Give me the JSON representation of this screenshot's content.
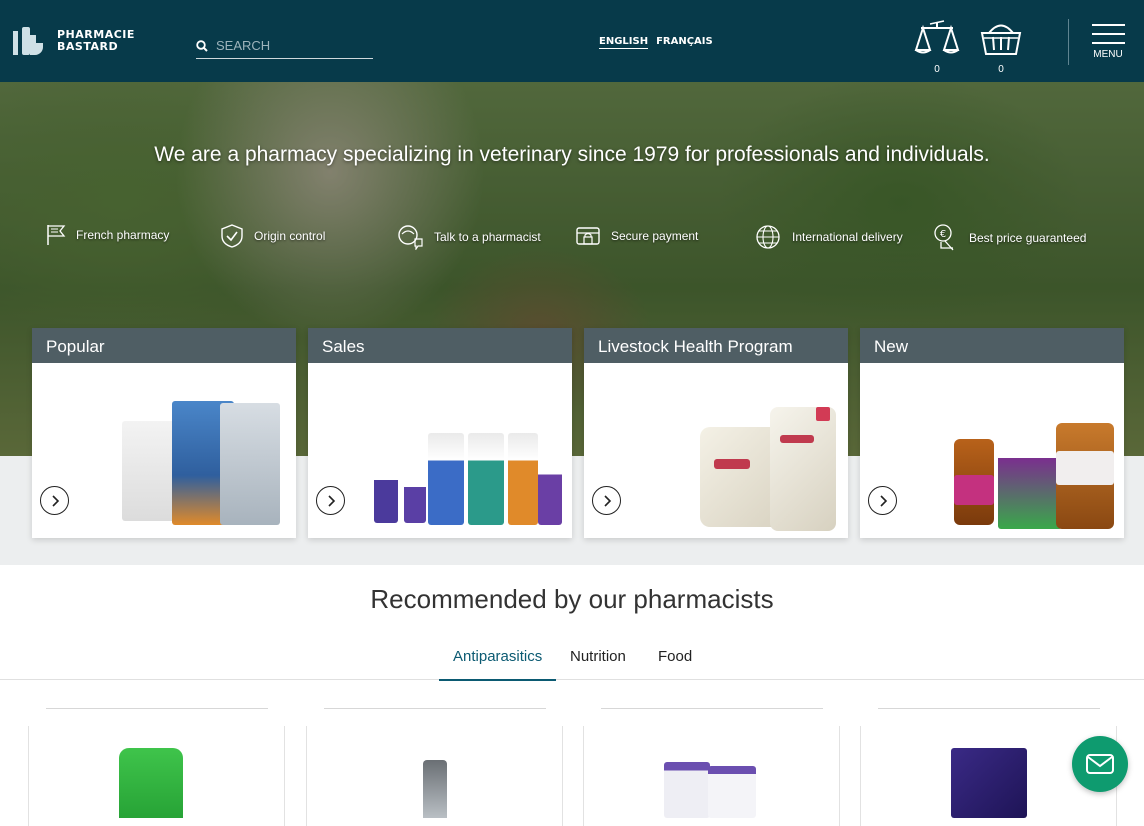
{
  "header": {
    "logo_line1": "PHARMACIE",
    "logo_line2": "BASTARD",
    "search_placeholder": "SEARCH",
    "lang_english": "ENGLISH",
    "lang_french": "FRANÇAIS",
    "compare_count": "0",
    "cart_count": "0",
    "menu_label": "MENU"
  },
  "hero": {
    "headline": "We are a pharmacy specializing in veterinary since 1979 for professionals and individuals.",
    "features": [
      {
        "label": "French pharmacy",
        "icon": "flag-icon"
      },
      {
        "label": "Origin control",
        "icon": "shield-check-icon"
      },
      {
        "label": "Talk to a pharmacist",
        "icon": "pharmacist-icon"
      },
      {
        "label": "Secure payment",
        "icon": "lock-icon"
      },
      {
        "label": "International delivery",
        "icon": "globe-icon"
      },
      {
        "label": "Best price guaranteed",
        "icon": "euro-price-icon"
      }
    ]
  },
  "categories": [
    {
      "title": "Popular"
    },
    {
      "title": "Sales"
    },
    {
      "title": "Livestock Health Program"
    },
    {
      "title": "New"
    }
  ],
  "recommended": {
    "title": "Recommended by our pharmacists",
    "tabs": [
      "Antiparasitics",
      "Nutrition",
      "Food"
    ],
    "active_tab": "Antiparasitics"
  },
  "colors": {
    "header_bg": "#073a4a",
    "accent": "#0b5a72",
    "chat_button": "#0e9b6f"
  }
}
